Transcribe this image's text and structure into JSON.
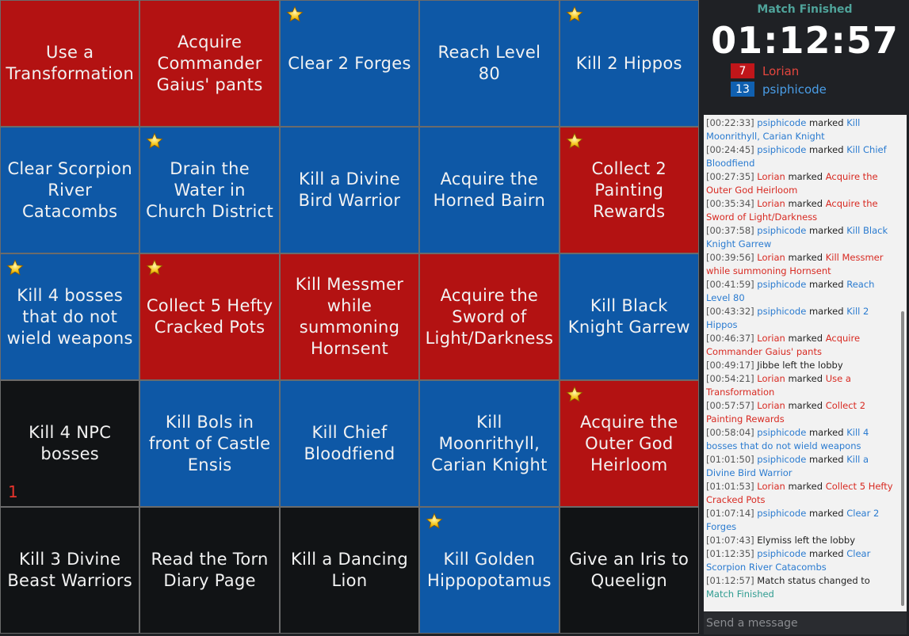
{
  "board": [
    {
      "text": "Use a Transformation",
      "color": "red",
      "star": false
    },
    {
      "text": "Acquire Commander Gaius' pants",
      "color": "red",
      "star": false
    },
    {
      "text": "Clear 2 Forges",
      "color": "blue",
      "star": true
    },
    {
      "text": "Reach Level 80",
      "color": "blue",
      "star": false
    },
    {
      "text": "Kill 2 Hippos",
      "color": "blue",
      "star": true
    },
    {
      "text": "Clear Scorpion River Catacombs",
      "color": "blue",
      "star": false
    },
    {
      "text": "Drain the Water in Church District",
      "color": "blue",
      "star": true
    },
    {
      "text": "Kill a Divine Bird Warrior",
      "color": "blue",
      "star": false
    },
    {
      "text": "Acquire the Horned Bairn",
      "color": "blue",
      "star": false
    },
    {
      "text": "Collect 2 Painting Rewards",
      "color": "red",
      "star": true
    },
    {
      "text": "Kill 4 bosses that do not wield weapons",
      "color": "blue",
      "star": true
    },
    {
      "text": "Collect 5 Hefty Cracked Pots",
      "color": "red",
      "star": true
    },
    {
      "text": "Kill Messmer while summoning Hornsent",
      "color": "red",
      "star": false
    },
    {
      "text": "Acquire the Sword of Light/Darkness",
      "color": "red",
      "star": false
    },
    {
      "text": "Kill Black Knight Garrew",
      "color": "blue",
      "star": false
    },
    {
      "text": "Kill 4 NPC bosses",
      "color": "black",
      "star": false,
      "counter": "1"
    },
    {
      "text": "Kill Bols in front of Castle Ensis",
      "color": "blue",
      "star": false
    },
    {
      "text": "Kill Chief Bloodfiend",
      "color": "blue",
      "star": false
    },
    {
      "text": "Kill Moonrithyll, Carian Knight",
      "color": "blue",
      "star": false
    },
    {
      "text": "Acquire the Outer God Heirloom",
      "color": "red",
      "star": true
    },
    {
      "text": "Kill 3 Divine Beast Warriors",
      "color": "black",
      "star": false
    },
    {
      "text": "Read the Torn Diary Page",
      "color": "black",
      "star": false
    },
    {
      "text": "Kill a Dancing Lion",
      "color": "black",
      "star": false
    },
    {
      "text": "Kill Golden Hippopotamus",
      "color": "blue",
      "star": true
    },
    {
      "text": "Give an Iris to Queelign",
      "color": "black",
      "star": false
    }
  ],
  "side": {
    "status": "Match Finished",
    "timer": "01:12:57",
    "teams": [
      {
        "score": "7",
        "name": "Lorian",
        "color": "red"
      },
      {
        "score": "13",
        "name": "psiphicode",
        "color": "blue"
      }
    ]
  },
  "log": [
    {
      "time": "[00:22:33]",
      "player": "psiphicode",
      "pcolor": "blue",
      "action": "marked",
      "target": "Kill Moonrithyll, Carian Knight",
      "tcolor": "blue"
    },
    {
      "time": "[00:24:45]",
      "player": "psiphicode",
      "pcolor": "blue",
      "action": "marked",
      "target": "Kill Chief Bloodfiend",
      "tcolor": "blue"
    },
    {
      "time": "[00:27:35]",
      "player": "Lorian",
      "pcolor": "red",
      "action": "marked",
      "target": "Acquire the Outer God Heirloom",
      "tcolor": "red"
    },
    {
      "time": "[00:35:34]",
      "player": "Lorian",
      "pcolor": "red",
      "action": "marked",
      "target": "Acquire the Sword of Light/Darkness",
      "tcolor": "red"
    },
    {
      "time": "[00:37:58]",
      "player": "psiphicode",
      "pcolor": "blue",
      "action": "marked",
      "target": "Kill Black Knight Garrew",
      "tcolor": "blue"
    },
    {
      "time": "[00:39:56]",
      "player": "Lorian",
      "pcolor": "red",
      "action": "marked",
      "target": "Kill Messmer while summoning Hornsent",
      "tcolor": "red"
    },
    {
      "time": "[00:41:59]",
      "player": "psiphicode",
      "pcolor": "blue",
      "action": "marked",
      "target": "Reach Level 80",
      "tcolor": "blue"
    },
    {
      "time": "[00:43:32]",
      "player": "psiphicode",
      "pcolor": "blue",
      "action": "marked",
      "target": "Kill 2 Hippos",
      "tcolor": "blue"
    },
    {
      "time": "[00:46:37]",
      "player": "Lorian",
      "pcolor": "red",
      "action": "marked",
      "target": "Acquire Commander Gaius' pants",
      "tcolor": "red"
    },
    {
      "time": "[00:49:17]",
      "player": "",
      "pcolor": "",
      "action": "Jibbe left the lobby",
      "target": "",
      "tcolor": ""
    },
    {
      "time": "[00:54:21]",
      "player": "Lorian",
      "pcolor": "red",
      "action": "marked",
      "target": "Use a Transformation",
      "tcolor": "red"
    },
    {
      "time": "[00:57:57]",
      "player": "Lorian",
      "pcolor": "red",
      "action": "marked",
      "target": "Collect 2 Painting Rewards",
      "tcolor": "red"
    },
    {
      "time": "[00:58:04]",
      "player": "psiphicode",
      "pcolor": "blue",
      "action": "marked",
      "target": "Kill 4 bosses that do not wield weapons",
      "tcolor": "blue"
    },
    {
      "time": "[01:01:50]",
      "player": "psiphicode",
      "pcolor": "blue",
      "action": "marked",
      "target": "Kill a Divine Bird Warrior",
      "tcolor": "blue"
    },
    {
      "time": "[01:01:53]",
      "player": "Lorian",
      "pcolor": "red",
      "action": "marked",
      "target": "Collect 5 Hefty Cracked Pots",
      "tcolor": "red"
    },
    {
      "time": "[01:07:14]",
      "player": "psiphicode",
      "pcolor": "blue",
      "action": "marked",
      "target": "Clear 2 Forges",
      "tcolor": "blue"
    },
    {
      "time": "[01:07:43]",
      "player": "",
      "pcolor": "",
      "action": "Elymiss left the lobby",
      "target": "",
      "tcolor": ""
    },
    {
      "time": "[01:12:35]",
      "player": "psiphicode",
      "pcolor": "blue",
      "action": "marked",
      "target": "Clear Scorpion River Catacombs",
      "tcolor": "blue"
    },
    {
      "time": "[01:12:57]",
      "player": "",
      "pcolor": "",
      "action": "Match status changed to",
      "target": "Match Finished",
      "tcolor": "green"
    }
  ],
  "chat": {
    "placeholder": "Send a message"
  },
  "colors": {
    "red": "#b31212",
    "blue": "#0e58a6",
    "black": "#111315",
    "accent": "#4fa39a"
  }
}
